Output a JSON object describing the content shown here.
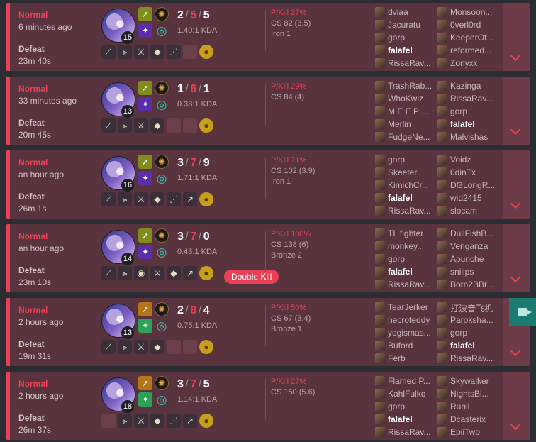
{
  "matches": [
    {
      "queue": "Normal",
      "time_ago": "6 minutes ago",
      "result": "Defeat",
      "duration": "23m 40s",
      "level": "15",
      "kills": "2",
      "deaths": "5",
      "assists": "5",
      "kda": "1.40:1 KDA",
      "pkill": "P/Kill 37%",
      "cs": "CS 82 (3.5)",
      "rank": "Iron 1",
      "multikill": "",
      "spell_alt": false,
      "items": [
        "blade",
        "boots",
        "sword",
        "crystal",
        "claw",
        "empty",
        "ward"
      ],
      "blue_team": [
        "dviaa",
        "Jacuratu",
        "gorp",
        "falafel",
        "RissaRav..."
      ],
      "red_team": [
        "Monsoon...",
        "0verl0rd",
        "KeeperOf...",
        "reformed...",
        "Zonyxx"
      ],
      "me_index": 3,
      "me_team": "blue"
    },
    {
      "queue": "Normal",
      "time_ago": "33 minutes ago",
      "result": "Defeat",
      "duration": "20m 45s",
      "level": "13",
      "kills": "1",
      "deaths": "6",
      "assists": "1",
      "kda": "0.33:1 KDA",
      "pkill": "P/Kill 29%",
      "cs": "CS 84 (4)",
      "rank": "",
      "multikill": "",
      "spell_alt": false,
      "items": [
        "blade",
        "boots",
        "sword",
        "crystal",
        "empty",
        "empty",
        "ward"
      ],
      "blue_team": [
        "TrashRab...",
        "WhoKwiz",
        "M E E P ...",
        "Merlin",
        "FudgeNe..."
      ],
      "red_team": [
        "Kazinga",
        "RissaRav...",
        "gorp",
        "falafel",
        "Malvishas"
      ],
      "me_index": 3,
      "me_team": "red"
    },
    {
      "queue": "Normal",
      "time_ago": "an hour ago",
      "result": "Defeat",
      "duration": "26m 1s",
      "level": "16",
      "kills": "3",
      "deaths": "7",
      "assists": "9",
      "kda": "1.71:1 KDA",
      "pkill": "P/Kill 71%",
      "cs": "CS 102 (3.9)",
      "rank": "Iron 1",
      "multikill": "",
      "spell_alt": false,
      "items": [
        "blade",
        "boots",
        "sword",
        "crystal",
        "claw",
        "spear",
        "ward"
      ],
      "blue_team": [
        "gorp",
        "Skeeter",
        "KimichCr...",
        "falafel",
        "RissaRav..."
      ],
      "red_team": [
        "Voidz",
        "0dinTx",
        "DGLongR...",
        "wid2415",
        "slocam"
      ],
      "me_index": 3,
      "me_team": "blue"
    },
    {
      "queue": "Normal",
      "time_ago": "an hour ago",
      "result": "Defeat",
      "duration": "23m 10s",
      "level": "14",
      "kills": "3",
      "deaths": "7",
      "assists": "0",
      "kda": "0.43:1 KDA",
      "pkill": "P/Kill 100%",
      "cs": "CS 138 (6)",
      "rank": "Bronze 2",
      "multikill": "Double Kill",
      "spell_alt": false,
      "items": [
        "blade",
        "boots",
        "shield",
        "sword",
        "crystal",
        "spear",
        "ward"
      ],
      "blue_team": [
        "TL fighter",
        "monkey...",
        "gorp",
        "falafel",
        "RissaRav..."
      ],
      "red_team": [
        "DullFishB...",
        "Venganza",
        "Apunche",
        "sniiips",
        "Born2BBr..."
      ],
      "me_index": 3,
      "me_team": "blue"
    },
    {
      "queue": "Normal",
      "time_ago": "2 hours ago",
      "result": "Defeat",
      "duration": "19m 31s",
      "level": "13",
      "kills": "2",
      "deaths": "8",
      "assists": "4",
      "kda": "0.75:1 KDA",
      "pkill": "P/Kill 50%",
      "cs": "CS 67 (3.4)",
      "rank": "Bronze 1",
      "multikill": "",
      "spell_alt": true,
      "items": [
        "blade",
        "boots",
        "sword",
        "crystal",
        "empty",
        "empty",
        "ward"
      ],
      "blue_team": [
        "TearJerker",
        "necroteddy",
        "yogismas...",
        "Buford",
        "Ferb"
      ],
      "red_team": [
        "打波音飞机",
        "Paroksha...",
        "gorp",
        "falafel",
        "RissaRav..."
      ],
      "me_index": 3,
      "me_team": "red"
    },
    {
      "queue": "Normal",
      "time_ago": "2 hours ago",
      "result": "Defeat",
      "duration": "26m 37s",
      "level": "18",
      "kills": "3",
      "deaths": "7",
      "assists": "5",
      "kda": "1.14:1 KDA",
      "pkill": "P/Kill 27%",
      "cs": "CS 150 (5.6)",
      "rank": "",
      "multikill": "",
      "spell_alt": true,
      "items": [
        "empty",
        "boots",
        "sword",
        "crystal",
        "claw",
        "spear",
        "ward"
      ],
      "blue_team": [
        "Flamed P...",
        "KahlFulko",
        "gorp",
        "falafel",
        "RissaRav..."
      ],
      "red_team": [
        "Skywalker",
        "NightsBl...",
        "Runii",
        "Dcasterix",
        "EpiiTwo"
      ],
      "me_index": 3,
      "me_team": "blue"
    }
  ],
  "icons": {
    "blade": "⟋",
    "boots": "⫸",
    "sword": "⚔",
    "crystal": "◆",
    "claw": "⋰",
    "spear": "↗",
    "shield": "◉",
    "ward": "●",
    "empty": "",
    "spell_1": "➚",
    "spell_2": "✦",
    "rune_1": "✺",
    "rune_2": "◎"
  },
  "record_button_icon": "video-record-icon"
}
